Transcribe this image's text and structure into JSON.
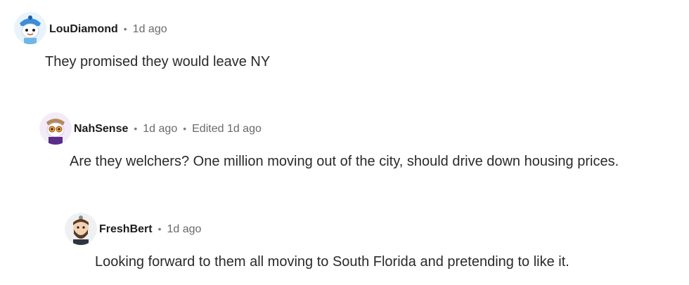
{
  "comments": [
    {
      "author": "LouDiamond",
      "age": "1d ago",
      "edited": "",
      "text": "They promised they would leave NY",
      "avatar_icon": "snoo-avatar-blue-cap-icon"
    },
    {
      "author": "NahSense",
      "age": "1d ago",
      "edited": "Edited 1d ago",
      "text": "Are they welchers? One million moving out of the city, should drive down housing prices.",
      "avatar_icon": "snoo-avatar-goggles-icon"
    },
    {
      "author": "FreshBert",
      "age": "1d ago",
      "edited": "",
      "text": "Looking forward to them all moving to South Florida and pretending to like it.",
      "avatar_icon": "snoo-avatar-bearded-icon"
    }
  ],
  "colors": {
    "author": "#1c1c1c",
    "meta": "#6a6a6a",
    "body": "#2a2a2a"
  }
}
